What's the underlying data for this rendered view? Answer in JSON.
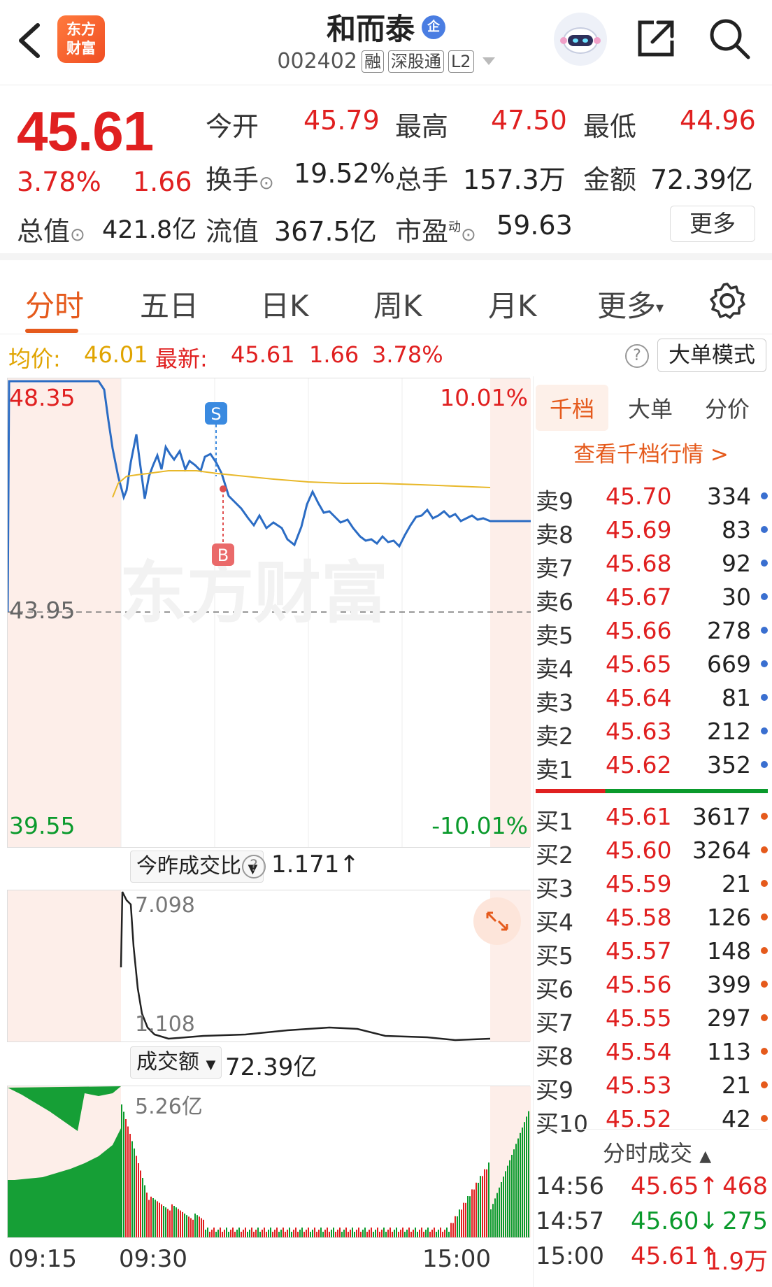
{
  "header": {
    "logo_text": "东方财富",
    "stock_name": "和而泰",
    "badge": "企",
    "code": "002402",
    "tags": [
      "融",
      "深股通",
      "L2"
    ]
  },
  "quote": {
    "price": "45.61",
    "pct": "3.78%",
    "change": "1.66",
    "open_label": "今开",
    "open": "45.79",
    "high_label": "最高",
    "high": "47.50",
    "low_label": "最低",
    "low": "44.96",
    "turnover_label": "换手",
    "turnover": "19.52%",
    "volume_label": "总手",
    "volume": "157.3万",
    "amount_label": "金额",
    "amount": "72.39亿",
    "mktcap_label": "总值",
    "mktcap": "421.8亿",
    "float_label": "流值",
    "float_cap": "367.5亿",
    "pe_label": "市盈",
    "pe_sup": "动",
    "pe": "59.63",
    "more": "更多"
  },
  "tabs": [
    "分时",
    "五日",
    "日K",
    "周K",
    "月K",
    "更多"
  ],
  "infoline": {
    "avg_label": "均价:",
    "avg": "46.01",
    "latest_label": "最新:",
    "latest": "45.61",
    "chg": "1.66",
    "pct": "3.78%",
    "big_order_btn": "大单模式"
  },
  "price_chart": {
    "y_top": "48.35",
    "y_mid": "43.95",
    "y_bot": "39.55",
    "pct_top": "10.01%",
    "pct_bot": "-10.01%",
    "marker_s": "S",
    "marker_b": "B",
    "watermark": "东方财富"
  },
  "ratio_chart": {
    "selector": "今昨成交比",
    "value": "1.171",
    "arrow": "↑",
    "y_top": "7.098",
    "y_bot": "1.108"
  },
  "amount_chart": {
    "selector": "成交额",
    "value": "72.39亿",
    "y_top": "5.26亿",
    "x_labels": [
      "09:15",
      "09:30",
      "15:00"
    ]
  },
  "orderbook": {
    "tabs": [
      "千档",
      "大单",
      "分价"
    ],
    "link": "查看千档行情 >",
    "asks": [
      {
        "name": "卖9",
        "price": "45.70",
        "vol": "334"
      },
      {
        "name": "卖8",
        "price": "45.69",
        "vol": "83"
      },
      {
        "name": "卖7",
        "price": "45.68",
        "vol": "92"
      },
      {
        "name": "卖6",
        "price": "45.67",
        "vol": "30"
      },
      {
        "name": "卖5",
        "price": "45.66",
        "vol": "278"
      },
      {
        "name": "卖4",
        "price": "45.65",
        "vol": "669"
      },
      {
        "name": "卖3",
        "price": "45.64",
        "vol": "81"
      },
      {
        "name": "卖2",
        "price": "45.63",
        "vol": "212"
      },
      {
        "name": "卖1",
        "price": "45.62",
        "vol": "352"
      }
    ],
    "bids": [
      {
        "name": "买1",
        "price": "45.61",
        "vol": "3617"
      },
      {
        "name": "买2",
        "price": "45.60",
        "vol": "3264"
      },
      {
        "name": "买3",
        "price": "45.59",
        "vol": "21"
      },
      {
        "name": "买4",
        "price": "45.58",
        "vol": "126"
      },
      {
        "name": "买5",
        "price": "45.57",
        "vol": "148"
      },
      {
        "name": "买6",
        "price": "45.56",
        "vol": "399"
      },
      {
        "name": "买7",
        "price": "45.55",
        "vol": "297"
      },
      {
        "name": "买8",
        "price": "45.54",
        "vol": "113"
      },
      {
        "name": "买9",
        "price": "45.53",
        "vol": "21"
      },
      {
        "name": "买10",
        "price": "45.52",
        "vol": "42"
      }
    ],
    "ticks_title": "分时成交",
    "ticks": [
      {
        "time": "14:56",
        "price": "45.65",
        "dir": "↑",
        "vol": "468"
      },
      {
        "time": "14:57",
        "price": "45.60",
        "dir": "↓",
        "vol": "275"
      },
      {
        "time": "15:00",
        "price": "45.61",
        "dir": "↑",
        "vol": "1.9万"
      }
    ]
  },
  "colors": {
    "up": "#e02020",
    "down": "#0a9a2c",
    "accent": "#e55a1c",
    "avg": "#e0a400",
    "line": "#2b6cc4"
  }
}
